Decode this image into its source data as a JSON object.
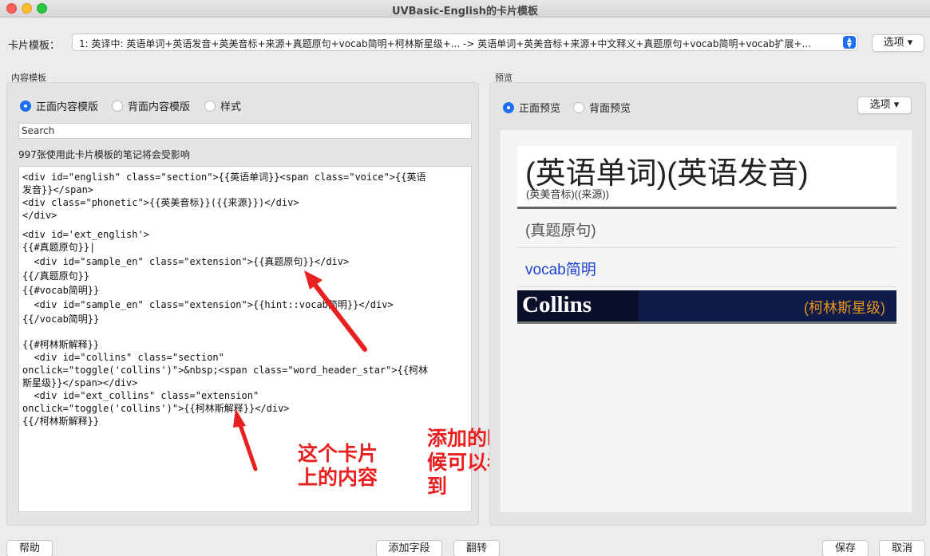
{
  "window": {
    "title": "UVBasic-English的卡片模板"
  },
  "template": {
    "label": "卡片模板：",
    "selected": "1: 英译中: 英语单词+英语发音+英美音标+来源+真题原句+vocab简明+柯林斯星级+... -> 英语单词+英美音标+来源+中文释义+真题原句+vocab简明+vocab扩展+...",
    "options_label": "选项 ▾"
  },
  "content": {
    "group_title": "内容模板",
    "radios": [
      "正面内容模版",
      "背面内容模版",
      "样式"
    ],
    "search_placeholder": "Search",
    "affect_text": "997张使用此卡片模板的笔记将会受影响",
    "code_lines": [
      "<div id=\"english\" class=\"section\">{{英语单词}}<span class=\"voice\">{{英语",
      "发音}}</span>",
      "<div class=\"phonetic\">{{英美音标}}({{来源}})</div>",
      "</div>",
      "",
      "<div id='ext_english'>",
      "{{#真题原句}}|",
      "  <div id=\"sample_en\" class=\"extension\">{{真题原句}}</div>",
      "{{/真题原句}}",
      "{{#vocab简明}}",
      "  <div id=\"sample_en\" class=\"extension\">{{hint::vocab简明}}</div>",
      "{{/vocab简明}}",
      "",
      "{{#柯林斯解释}}",
      "  <div id=\"collins\" class=\"section\"",
      "onclick=\"toggle('collins')\">&nbsp;<span class=\"word_header_star\">{{柯林",
      "斯星级}}</span></div>",
      "  <div id=\"ext_collins\" class=\"extension\"",
      "onclick=\"toggle('collins')\">{{柯林斯解释}}</div>",
      "{{/柯林斯解释}}"
    ]
  },
  "annotations": {
    "left": "这个卡片\n上的内容",
    "right": "添加的时\n候可以看\n到"
  },
  "preview": {
    "group_title": "预览",
    "radios": [
      "正面预览",
      "背面预览"
    ],
    "options_label": "选项 ▾",
    "word": "(英语单词)(英语发音)",
    "phonetic": "(英美音标)((来源))",
    "sample": "(真题原句)",
    "vocab": "vocab简明",
    "collins_logo": "Collins",
    "collins_star": "(柯林斯星级)"
  },
  "buttons": {
    "help": "帮助",
    "add_field": "添加字段",
    "flip": "翻转",
    "save": "保存",
    "cancel": "取消"
  },
  "colors": {
    "accent": "#1e6ff2",
    "annotation": "#ea1f1f",
    "collins_bg": "#0e1b4b",
    "collins_star": "#e79318"
  }
}
